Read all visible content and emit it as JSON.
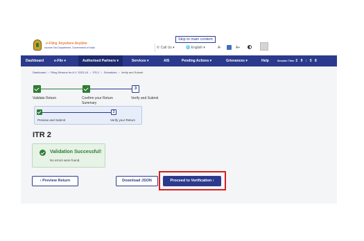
{
  "header": {
    "logo_title": "e-Filing",
    "logo_tagline": "Anywhere Anytime",
    "logo_sub": "Income Tax Department, Government of India",
    "skip_link": "Skip to main content",
    "call_us": "Call Us",
    "language": "English",
    "font_decrease": "A-",
    "font_normal": "A",
    "font_increase": "A+"
  },
  "nav": {
    "items": [
      "Dashboard",
      "e-File",
      "Authorised Partners",
      "Services",
      "AIS",
      "Pending Actions",
      "Grievances",
      "Help"
    ],
    "session_label": "Session Time",
    "session_value": "2 9 : 5 8"
  },
  "breadcrumb": [
    "Dashboard",
    "Filing Returns for A.Y. 2023-24",
    "ITR-2",
    "Schedules",
    "Verify and Submit"
  ],
  "stepper": {
    "steps": [
      {
        "label": "Validate Return",
        "state": "done"
      },
      {
        "label": "Confirm your Return Summary",
        "state": "done"
      },
      {
        "label": "Verify and Submit",
        "state": "current",
        "number": "3"
      }
    ],
    "substeps": [
      {
        "label": "Preview and Submit",
        "state": "done"
      },
      {
        "label": "Verify your Return",
        "state": "current",
        "number": "2"
      }
    ]
  },
  "page_title": "ITR 2",
  "validation": {
    "title": "Validation Successful!",
    "message": "No errors were found."
  },
  "actions": {
    "preview": "Preview Return",
    "download": "Download JSON",
    "proceed": "Proceed to Verification"
  },
  "colors": {
    "brand": "#2b3a8c",
    "success": "#2e7d32",
    "highlight": "#d81e1e"
  }
}
